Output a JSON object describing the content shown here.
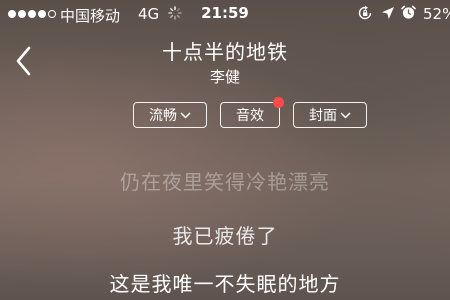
{
  "status_bar": {
    "signal_filled": 4,
    "signal_total": 5,
    "carrier": "中国移动",
    "network": "4G",
    "time": "21:59",
    "battery": "52%",
    "icons": [
      "loading-icon",
      "rotation-lock-icon",
      "location-icon",
      "alarm-icon"
    ]
  },
  "header": {
    "back_icon": "chevron-left-icon",
    "song_title": "十点半的地铁",
    "artist": "李健"
  },
  "options": {
    "quality_label": "流畅",
    "effect_label": "音效",
    "cover_label": "封面",
    "effect_badge_color": "#ff4a4a"
  },
  "lyrics": {
    "previous": "仍在夜里笑得冷艳漂亮",
    "current": "我已疲倦了",
    "next": "这是我唯一不失眠的地方"
  }
}
